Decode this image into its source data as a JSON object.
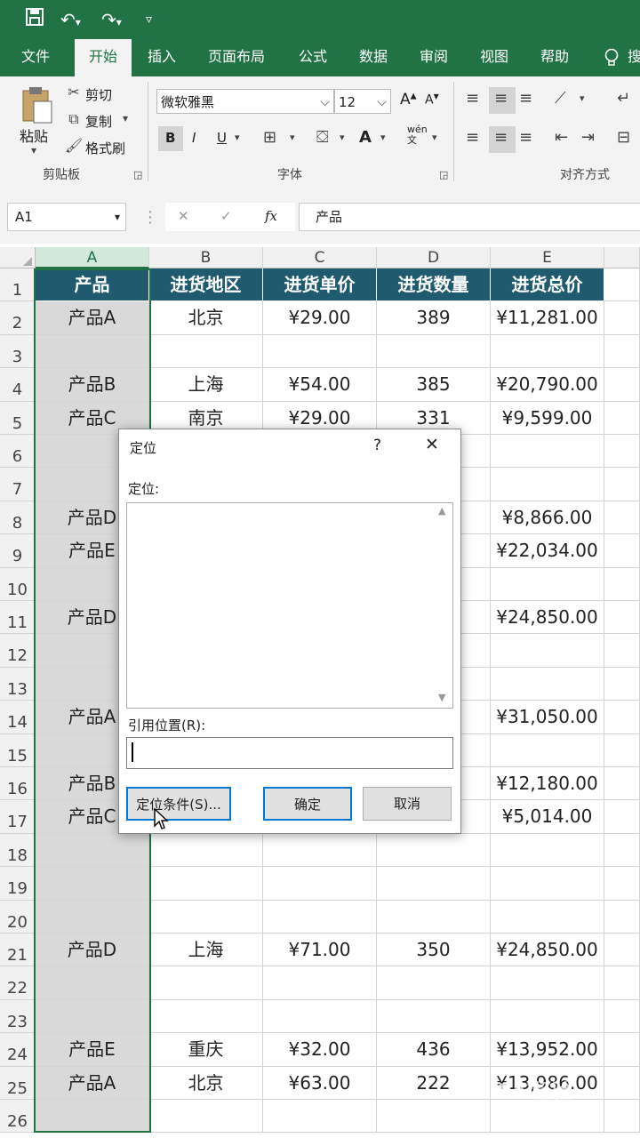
{
  "quick_access": {
    "save_icon": "save-icon",
    "undo_icon": "undo-icon",
    "redo_icon": "redo-icon",
    "customize_icon": "customize-icon"
  },
  "tabs": [
    "文件",
    "开始",
    "插入",
    "页面布局",
    "公式",
    "数据",
    "审阅",
    "视图",
    "帮助",
    "搜"
  ],
  "active_tab": "开始",
  "ribbon": {
    "clipboard": {
      "paste": "粘贴",
      "cut": "剪切",
      "copy": "复制",
      "format_painter": "格式刷",
      "group_label": "剪贴板"
    },
    "font": {
      "font_name": "微软雅黑",
      "font_size": "12",
      "bold": "B",
      "italic": "I",
      "underline": "U",
      "font_color": "A",
      "phonetic": "wén\n文",
      "group_label": "字体",
      "grow": "A",
      "shrink": "A"
    },
    "alignment": {
      "group_label": "对齐方式"
    }
  },
  "formula_bar": {
    "name_box": "A1",
    "cancel": "✕",
    "enter": "✓",
    "fx": "fx",
    "content": "产品"
  },
  "columns": [
    "A",
    "B",
    "C",
    "D",
    "E"
  ],
  "rows": [
    "1",
    "2",
    "3",
    "4",
    "5",
    "6",
    "7",
    "8",
    "9",
    "10",
    "11",
    "12",
    "13",
    "14",
    "15",
    "16",
    "17",
    "18",
    "19",
    "20",
    "21",
    "22",
    "23",
    "24",
    "25",
    "26"
  ],
  "table": {
    "header": [
      "产品",
      "进货地区",
      "进货单价",
      "进货数量",
      "进货总价"
    ],
    "data": [
      [
        "产品A",
        "北京",
        "¥29.00",
        "389",
        "¥11,281.00"
      ],
      [
        "",
        "",
        "",
        "",
        ""
      ],
      [
        "产品B",
        "上海",
        "¥54.00",
        "385",
        "¥20,790.00"
      ],
      [
        "产品C",
        "南京",
        "¥29.00",
        "331",
        "¥9,599.00"
      ],
      [
        "",
        "",
        "",
        "",
        ""
      ],
      [
        "",
        "",
        "",
        "",
        ""
      ],
      [
        "产品D",
        "",
        "",
        "",
        "¥8,866.00"
      ],
      [
        "产品E",
        "",
        "",
        "",
        "¥22,034.00"
      ],
      [
        "",
        "",
        "",
        "",
        ""
      ],
      [
        "产品D",
        "",
        "",
        "",
        "¥24,850.00"
      ],
      [
        "",
        "",
        "",
        "",
        ""
      ],
      [
        "",
        "",
        "",
        "",
        ""
      ],
      [
        "产品A",
        "",
        "",
        "",
        "¥31,050.00"
      ],
      [
        "",
        "",
        "",
        "",
        ""
      ],
      [
        "产品B",
        "",
        "",
        "",
        "¥12,180.00"
      ],
      [
        "产品C",
        "",
        "",
        "",
        "¥5,014.00"
      ],
      [
        "",
        "",
        "",
        "",
        ""
      ],
      [
        "",
        "",
        "",
        "",
        ""
      ],
      [
        "",
        "",
        "",
        "",
        ""
      ],
      [
        "产品D",
        "上海",
        "¥71.00",
        "350",
        "¥24,850.00"
      ],
      [
        "",
        "",
        "",
        "",
        ""
      ],
      [
        "",
        "",
        "",
        "",
        ""
      ],
      [
        "产品E",
        "重庆",
        "¥32.00",
        "436",
        "¥13,952.00"
      ],
      [
        "产品A",
        "北京",
        "¥63.00",
        "222",
        "¥13,986.00"
      ],
      [
        "",
        "",
        "",
        "",
        ""
      ]
    ]
  },
  "dialog": {
    "title": "定位",
    "help": "?",
    "close": "✕",
    "list_label": "定位:",
    "ref_label": "引用位置(R):",
    "ref_value": "",
    "special_button": "定位条件(S)...",
    "ok_button": "确定",
    "cancel_button": "取消"
  },
  "watermark": "Bai经验",
  "colors": {
    "excel_green": "#217346",
    "header_fill": "#1f5a6e",
    "selected_col": "#d9d9d9"
  }
}
